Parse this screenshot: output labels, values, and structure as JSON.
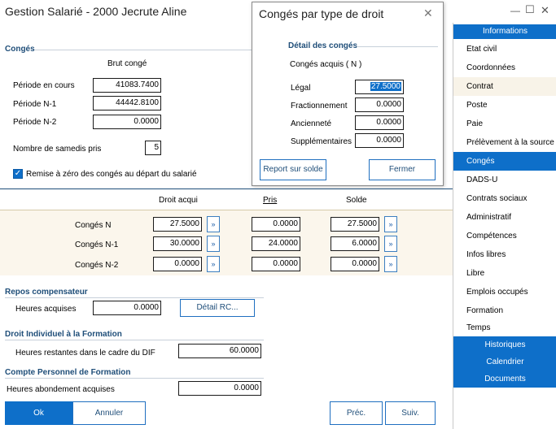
{
  "window": {
    "title": "Gestion Salarié - 2000 Jecrute Aline",
    "controls": {
      "minimize": "—",
      "maximize": "☐",
      "close": "✕"
    }
  },
  "conges": {
    "section_title": "Congés",
    "brut_header": "Brut congé",
    "periode_en_cours": {
      "label": "Période en cours",
      "value": "41083.7400"
    },
    "periode_n1": {
      "label": "Période N-1",
      "value": "44442.8100"
    },
    "periode_n2": {
      "label": "Période N-2",
      "value": "0.0000"
    },
    "samedis": {
      "label": "Nombre de samedis pris",
      "value": "5"
    },
    "remise": {
      "label": "Remise à zéro des congés au départ du salarié",
      "checked": true
    }
  },
  "droits_table": {
    "headers": {
      "droit": "Droit acqui",
      "pris": "Pris",
      "solde": "Solde"
    },
    "rows": [
      {
        "label": "Congés N",
        "droit": "27.5000",
        "pris": "0.0000",
        "solde": "27.5000"
      },
      {
        "label": "Congés N-1",
        "droit": "30.0000",
        "pris": "24.0000",
        "solde": "6.0000"
      },
      {
        "label": "Congés N-2",
        "droit": "0.0000",
        "pris": "0.0000",
        "solde": "0.0000"
      }
    ],
    "arrow_label": "»"
  },
  "repos": {
    "section_title": "Repos compensateur",
    "heures_label": "Heures acquises",
    "heures_value": "0.0000",
    "detail_button": "Détail RC..."
  },
  "dif": {
    "section_title": "Droit Individuel à la Formation",
    "label": "Heures restantes dans le cadre du DIF",
    "value": "60.0000"
  },
  "cpf": {
    "section_title": "Compte Personnel de Formation",
    "label": "Heures abondement acquises",
    "value": "0.0000"
  },
  "footer": {
    "ok": "Ok",
    "annuler": "Annuler",
    "prec": "Préc.",
    "suiv": "Suiv."
  },
  "sidebar": {
    "header": "Informations",
    "items": [
      "Etat civil",
      "Coordonnées",
      "Contrat",
      "Poste",
      "Paie",
      "Prélèvement à la source",
      "Congés",
      "DADS-U",
      "Contrats sociaux",
      "Administratif",
      "Compétences",
      "Infos libres",
      "Libre",
      "Emplois occupés",
      "Formation",
      "Temps"
    ],
    "sub_items": [
      "Historiques",
      "Calendrier",
      "Documents"
    ],
    "active": "Congés"
  },
  "dialog": {
    "title": "Congés par type de droit",
    "close": "✕",
    "section": "Détail des congés",
    "subtitle": "Congés acquis ( N )",
    "rows": [
      {
        "label": "Légal",
        "value": "27.5000"
      },
      {
        "label": "Fractionnement",
        "value": "0.0000"
      },
      {
        "label": "Ancienneté",
        "value": "0.0000"
      },
      {
        "label": "Supplémentaires",
        "value": "0.0000"
      }
    ],
    "report_button": "Report sur solde",
    "close_button": "Fermer"
  },
  "colors": {
    "accent": "#0e6fc9",
    "section": "#1f4e79",
    "band": "#fbf6ec"
  }
}
